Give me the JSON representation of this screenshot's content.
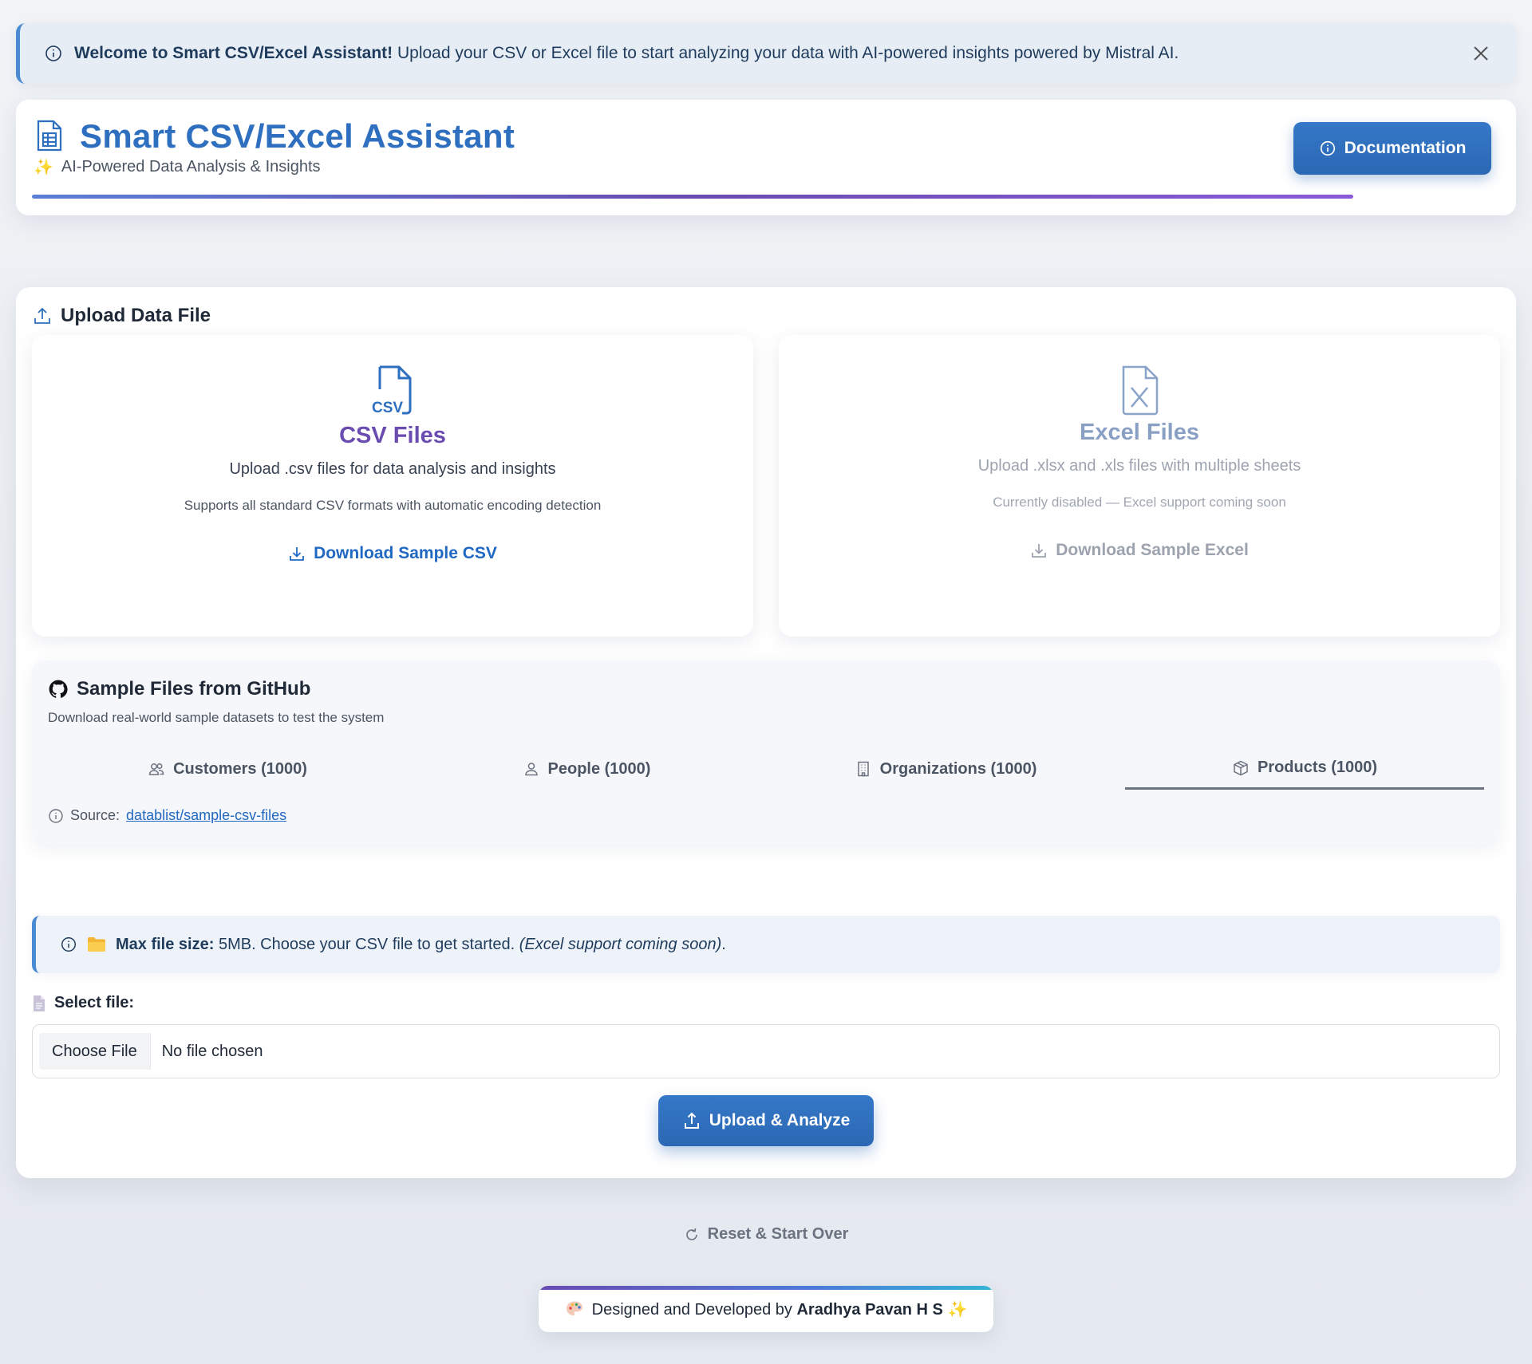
{
  "alert": {
    "bold": "Welcome to Smart CSV/Excel Assistant!",
    "text": " Upload your CSV or Excel file to start analyzing your data with AI-powered insights powered by Mistral AI."
  },
  "header": {
    "title": "Smart CSV/Excel Assistant",
    "sparkle": "✨",
    "subtitle": "AI-Powered Data Analysis & Insights",
    "doc_button": "Documentation"
  },
  "upload": {
    "section_title": "Upload Data File",
    "csv": {
      "icon_text": "CSV",
      "title": "CSV Files",
      "desc": "Upload .csv files for data analysis and insights",
      "note": "Supports all standard CSV formats with automatic encoding detection",
      "link": "Download Sample CSV"
    },
    "excel": {
      "title": "Excel Files",
      "desc": "Upload .xlsx and .xls files with multiple sheets",
      "note": "Currently disabled — Excel support coming soon",
      "link": "Download Sample Excel"
    }
  },
  "samples": {
    "title": "Sample Files from GitHub",
    "subtitle": "Download real-world sample datasets to test the system",
    "tabs": [
      {
        "label": "Customers (1000)",
        "icon": "users-icon"
      },
      {
        "label": "People (1000)",
        "icon": "person-icon"
      },
      {
        "label": "Organizations (1000)",
        "icon": "building-icon"
      },
      {
        "label": "Products (1000)",
        "icon": "box-icon",
        "active": true
      }
    ],
    "source_label": "Source:",
    "source_link": "datablist/sample-csv-files"
  },
  "info": {
    "bold": "Max file size:",
    "text": " 5MB. Choose your CSV file to get started. ",
    "italic": "(Excel support coming soon)",
    "end": "."
  },
  "file": {
    "label": "Select file:",
    "choose": "Choose File",
    "status": "No file chosen"
  },
  "actions": {
    "upload": "Upload & Analyze",
    "reset": "Reset & Start Over"
  },
  "footer": {
    "prefix": "Designed and Developed by",
    "author": "Aradhya Pavan H S",
    "sparkle": "✨"
  },
  "colors": {
    "primary": "#2f6fc0",
    "accent_purple": "#6a4bb0",
    "alert_bg": "#e6edf5"
  }
}
